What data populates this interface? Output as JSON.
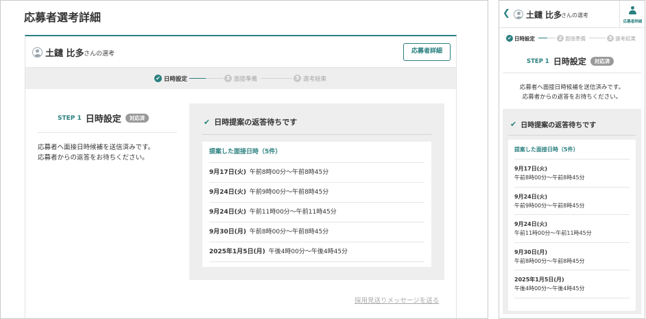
{
  "desktop": {
    "page_title": "応募者選考詳細",
    "applicant_name": "土鑓 比多",
    "applicant_suffix": "さんの選考",
    "detail_button": "応募者詳細",
    "steps": [
      {
        "num": "1",
        "label": "日時設定",
        "state": "done"
      },
      {
        "num": "2",
        "label": "面接準備",
        "state": "pending"
      },
      {
        "num": "3",
        "label": "選考結果",
        "state": "pending"
      }
    ],
    "step_tag": "STEP 1",
    "step_title": "日時設定",
    "step_badge": "対応済",
    "description_line1": "応募者へ面接日時候補を送信済みです。",
    "description_line2": "応募者からの返答をお待ちください。",
    "waiting_title": "日時提案の返答待ちです",
    "list_header": "提案した面接日時（5件）",
    "slots": [
      {
        "date": "9月17日(火)",
        "time": "午前8時00分〜午前8時45分"
      },
      {
        "date": "9月24日(火)",
        "time": "午前9時00分〜午前8時45分"
      },
      {
        "date": "9月24日(火)",
        "time": "午前11時00分〜午前11時45分"
      },
      {
        "date": "9月30日(月)",
        "time": "午前8時00分〜午前8時45分"
      },
      {
        "date": "2025年1月5日(月)",
        "time": "午後4時00分〜午後4時45分"
      }
    ],
    "send_link": "採用見送りメッセージを送る"
  },
  "mobile": {
    "back_icon": "chevron-left-icon",
    "applicant_name": "土鑓 比多",
    "applicant_suffix": "さんの選考",
    "detail_label": "応募者詳細",
    "steps": [
      {
        "num": "1",
        "label": "日時設定",
        "state": "done"
      },
      {
        "num": "2",
        "label": "面接準備",
        "state": "pending"
      },
      {
        "num": "3",
        "label": "選考結果",
        "state": "pending"
      }
    ],
    "step_tag": "STEP 1",
    "step_title": "日時設定",
    "step_badge": "対応済",
    "description_line1": "応募者へ面接日時候補を送信済みです。",
    "description_line2": "応募者からの返答をお待ちください。",
    "waiting_title": "日時提案の返答待ちです",
    "list_header": "提案した面接日時（5件）",
    "slots": [
      {
        "date": "9月17日(火)",
        "time": "午前8時00分〜午前8時45分"
      },
      {
        "date": "9月24日(火)",
        "time": "午前9時00分〜午前8時45分"
      },
      {
        "date": "9月24日(火)",
        "time": "午前11時00分〜午前11時45分"
      },
      {
        "date": "9月30日(月)",
        "time": "午前8時00分〜午前8時45分"
      },
      {
        "date": "2025年1月5日(月)",
        "time": "午後4時00分〜午後4時45分"
      }
    ]
  },
  "colors": {
    "accent": "#2a7f7f",
    "badge": "#999999",
    "panel_bg": "#eeeeee",
    "inactive": "#c9c9c9"
  }
}
